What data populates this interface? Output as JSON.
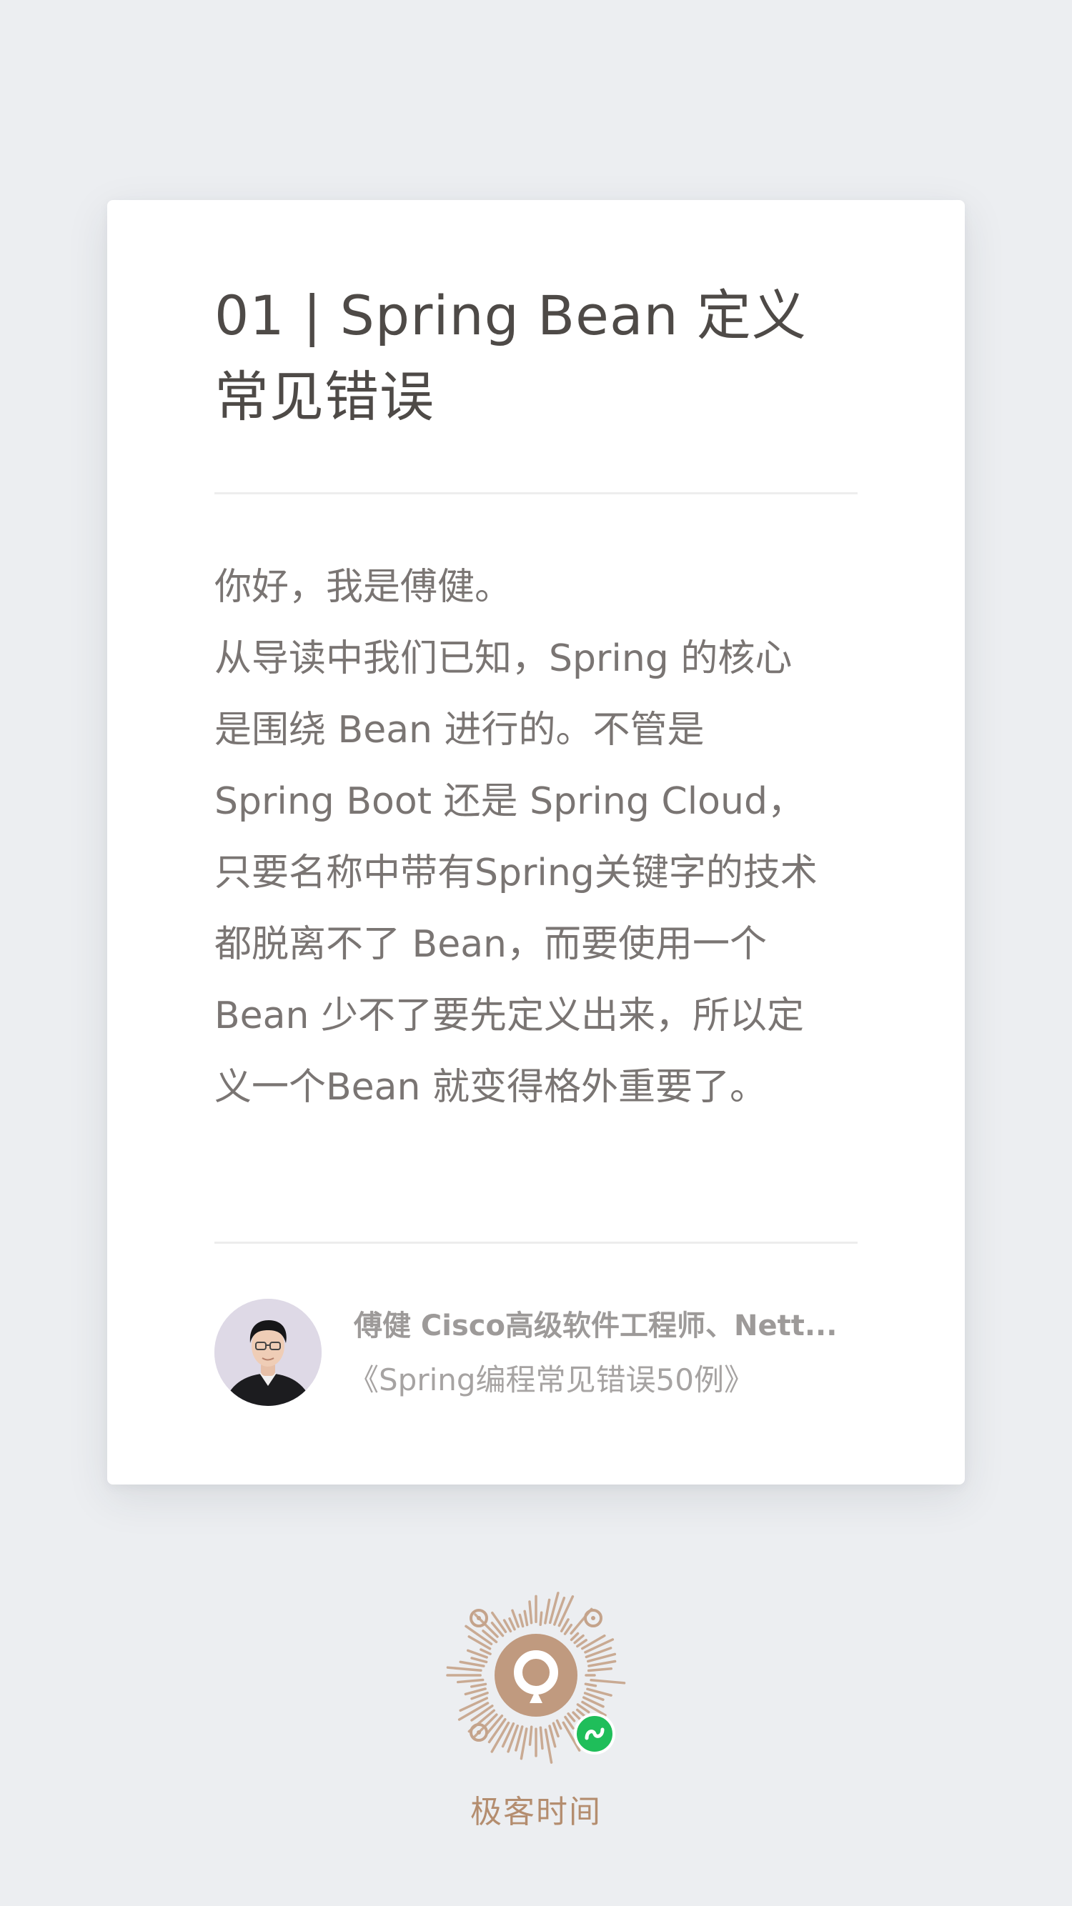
{
  "card": {
    "title": "01 | Spring Bean 定义\n常见错误",
    "paragraphs": [
      "你好，我是傅健。",
      "从导读中我们已知，Spring 的核心\n是围绕 Bean 进行的。不管是\nSpring Boot 还是 Spring Cloud，\n只要名称中带有Spring关键字的技术\n都脱离不了 Bean，而要使用一个\nBean 少不了要先定义出来，所以定\n义一个Bean 就变得格外重要了。"
    ],
    "author": {
      "line": "傅健 Cisco高级软件工程师、Nett...",
      "course": "《Spring编程常见错误50例》"
    }
  },
  "footer": {
    "brand": "极客时间",
    "qr_icon": "mini-program-qr-icon",
    "badge_icon": "wechat-mini-program-icon"
  },
  "colors": {
    "background": "#eceef1",
    "card": "#ffffff",
    "title": "#4e4a47",
    "body": "#7a7573",
    "brand": "#b48d6f",
    "badge": "#1fbe5a"
  }
}
